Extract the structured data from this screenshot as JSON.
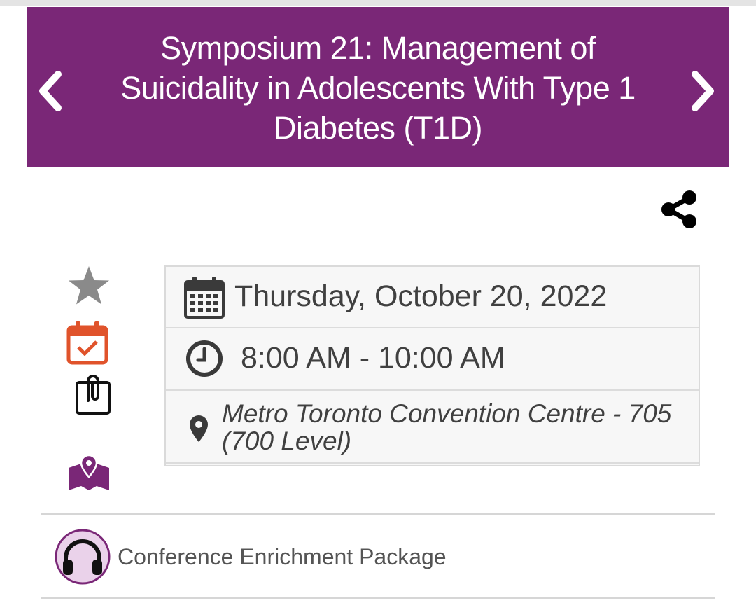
{
  "header": {
    "title": "Symposium 21: Management of Suicidality in Adolescents With Type 1 Diabetes (T1D)",
    "background_color": "#7a2777",
    "prev_icon": "chevron-left-icon",
    "next_icon": "chevron-right-icon"
  },
  "actions": {
    "share_icon": "share-icon",
    "favorite_icon": "star-icon",
    "add_to_calendar_icon": "calendar-check-icon",
    "attachment_icon": "clipboard-paperclip-icon",
    "map_icon": "map-pin-icon",
    "accent_colors": {
      "star": "#8a8a8a",
      "calendar": "#e0532b",
      "map": "#7a2777"
    }
  },
  "session": {
    "date": "Thursday, October 20, 2022",
    "time": "8:00 AM - 10:00 AM",
    "location": "Metro Toronto Convention Centre - 705 (700 Level)"
  },
  "enrichment": {
    "label": "Conference Enrichment Package",
    "icon": "headphones-icon"
  }
}
